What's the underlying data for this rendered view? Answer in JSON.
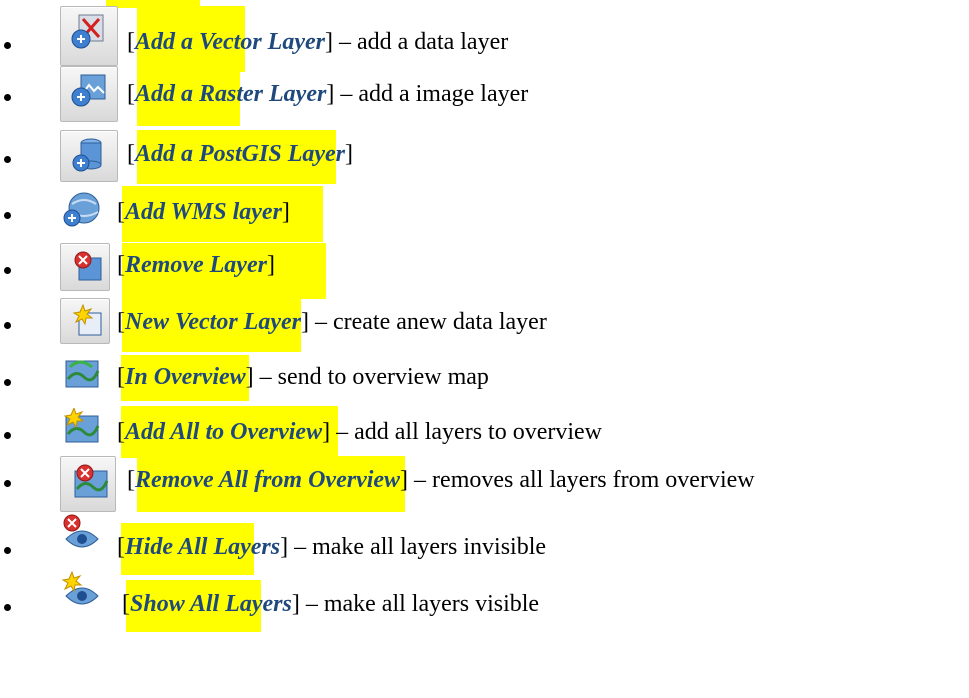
{
  "items": [
    {
      "icon": "add-vector-layer-icon",
      "name": "Add a Vector Layer",
      "desc": "– add a data layer"
    },
    {
      "icon": "add-raster-layer-icon",
      "name": "Add a Raster Layer",
      "desc": "– add a image layer"
    },
    {
      "icon": "add-postgis-layer-icon",
      "name": "Add a PostGIS Layer",
      "desc": ""
    },
    {
      "icon": "add-wms-layer-icon",
      "name": "Add WMS layer",
      "desc": ""
    },
    {
      "icon": "remove-layer-icon",
      "name": "Remove Layer",
      "desc": ""
    },
    {
      "icon": "new-vector-layer-icon",
      "name": "New Vector Layer",
      "desc": "– create anew data layer"
    },
    {
      "icon": "in-overview-icon",
      "name": "In Overview",
      "desc": "– send to overview map"
    },
    {
      "icon": "add-all-to-overview-icon",
      "name": "Add All to Overview",
      "desc": "– add all layers to overview"
    },
    {
      "icon": "remove-all-from-overview-icon",
      "name": "Remove All from Overview",
      "desc": "– removes all layers from overview"
    },
    {
      "icon": "hide-all-layers-icon",
      "name": "Hide All Layers",
      "desc": "– make all layers invisible"
    },
    {
      "icon": "show-all-layers-icon",
      "name": "Show All Layers",
      "desc": "– make all layers visible"
    }
  ],
  "colors": {
    "highlight": "#ffff00",
    "term": "#1f497d"
  }
}
